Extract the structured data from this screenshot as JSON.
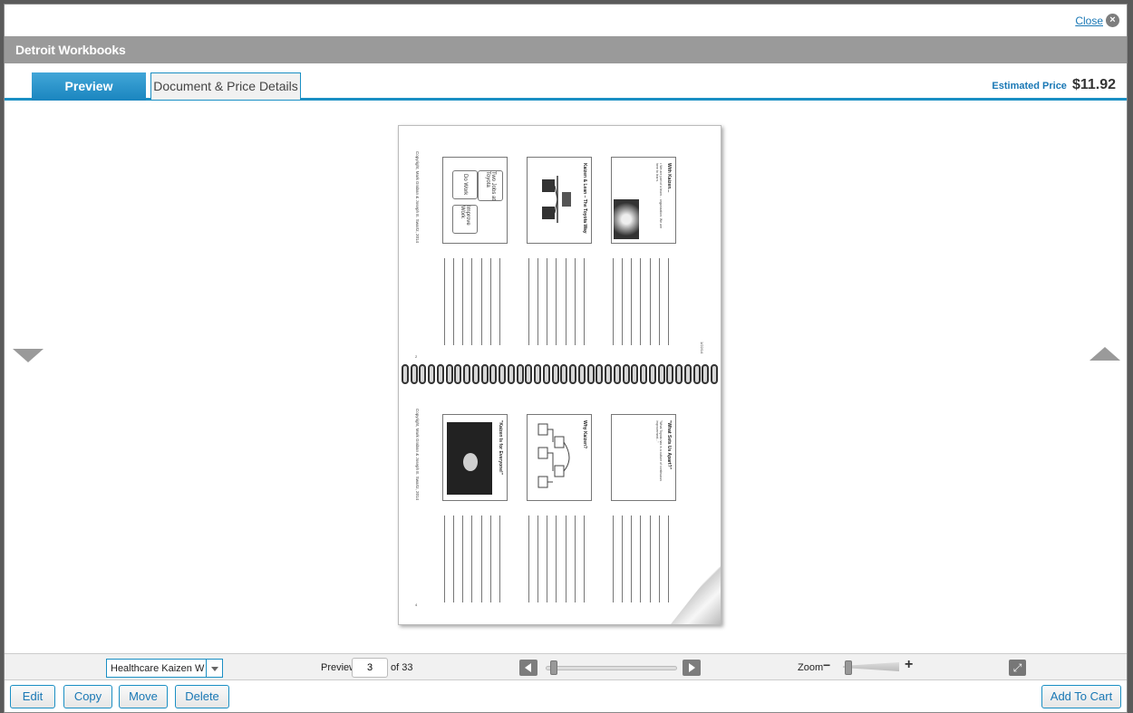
{
  "window": {
    "close_label": "Close",
    "close_icon": "x-circle-icon",
    "title": "Detroit Workbooks"
  },
  "tabs": [
    {
      "label": "Preview",
      "active": true
    },
    {
      "label": "Document & Price Details",
      "active": false
    }
  ],
  "price": {
    "label": "Estimated Price",
    "value": "$11.92"
  },
  "workbook": {
    "top_slides": [
      {
        "title": "Two Jobs at Toyota",
        "boxes": [
          "Do Work",
          "Improve Work"
        ]
      },
      {
        "title": "Kaizen & Lean – The Toyota Way"
      },
      {
        "title": "With Kaizen..."
      }
    ],
    "bottom_slides": [
      {
        "title": "\"Kaizen Is for Everyone!\""
      },
      {
        "title": "Why Kaizen?"
      },
      {
        "title": "\"What Sets Us Apart?\""
      }
    ]
  },
  "toolbar": {
    "document_select_value": "Healthcare Kaizen W",
    "preview_label": "Preview",
    "current_page": "3",
    "total_pages_label": "of 33",
    "zoom_label": "Zoom",
    "zoom_minus": "−",
    "zoom_plus": "+"
  },
  "actions": {
    "edit": "Edit",
    "copy": "Copy",
    "move": "Move",
    "delete": "Delete",
    "add_to_cart": "Add To Cart"
  },
  "colors": {
    "accent": "#1a8fc4",
    "titlebar": "#9a9a9a"
  }
}
